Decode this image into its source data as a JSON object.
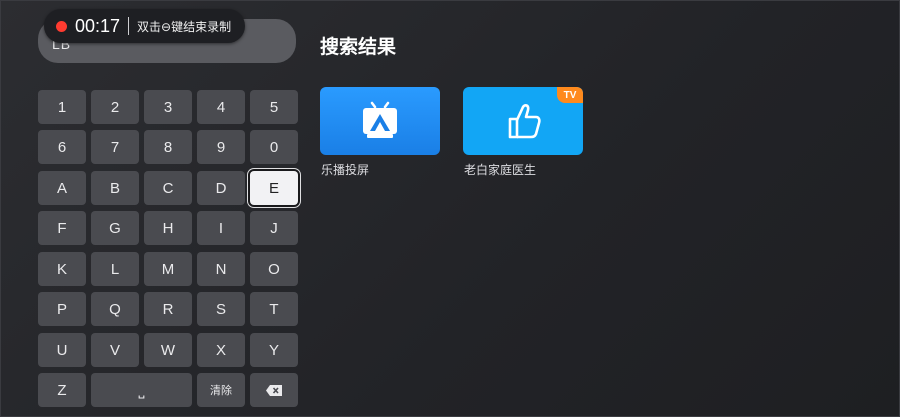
{
  "search": {
    "query": "LB"
  },
  "recording": {
    "time": "00:17",
    "hint": "双击⊖键结束录制"
  },
  "keyboard": {
    "rows": [
      [
        "1",
        "2",
        "3",
        "4",
        "5"
      ],
      [
        "6",
        "7",
        "8",
        "9",
        "0"
      ],
      [
        "A",
        "B",
        "C",
        "D",
        "E"
      ],
      [
        "F",
        "G",
        "H",
        "I",
        "J"
      ],
      [
        "K",
        "L",
        "M",
        "N",
        "O"
      ],
      [
        "P",
        "Q",
        "R",
        "S",
        "T"
      ],
      [
        "U",
        "V",
        "W",
        "X",
        "Y"
      ]
    ],
    "last_row": {
      "z": "Z",
      "space": "⎵",
      "clear": "清除",
      "backspace": "⌫"
    },
    "focused_key": "E"
  },
  "results": {
    "title": "搜索结果",
    "apps": [
      {
        "name": "乐播投屏",
        "icon": "cast-screen-icon",
        "color": "#1e8cf0"
      },
      {
        "name": "老白家庭医生",
        "icon": "thumbs-up-icon",
        "color": "#12a6f5",
        "badge": "TV"
      }
    ]
  }
}
